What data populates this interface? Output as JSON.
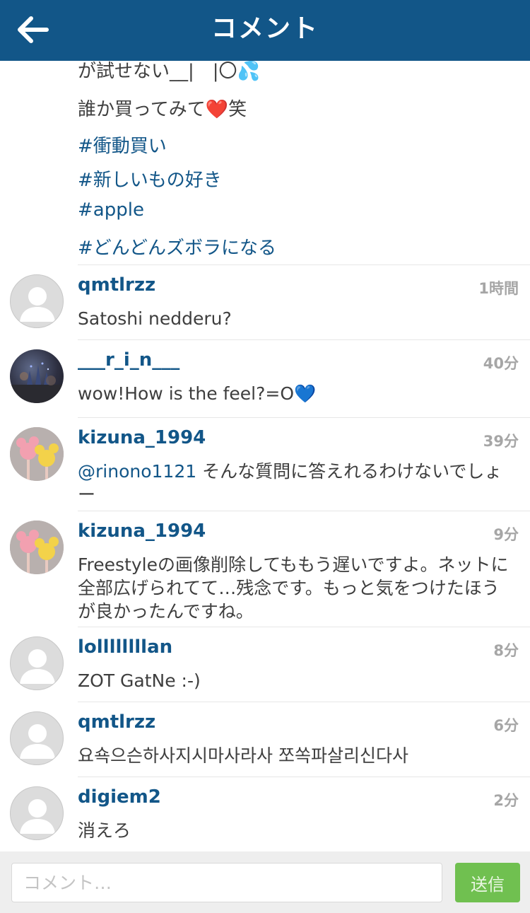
{
  "header": {
    "title": "コメント",
    "back_icon": "arrow-left-icon"
  },
  "caption": {
    "partial_line": "が試せない__|　|〇💦",
    "line2": "誰か買ってみて❤️笑",
    "tags": [
      "#衝動買い",
      "#新しいもの好き",
      "#apple",
      "#どんどんズボラになる"
    ]
  },
  "comments": [
    {
      "user": "qmtlrzz",
      "time": "1時間",
      "text": "Satoshi nedderu?",
      "avatar": "default-avatar-icon"
    },
    {
      "user": "___r_i_n___",
      "time": "40分",
      "text": "wow!How is the feel?=O💙",
      "avatar": "photo"
    },
    {
      "user": "kizuna_1994",
      "time": "39分",
      "mention": "@rinono1121",
      "text": " そんな質問に答えれるわけないでしょー",
      "avatar": "photo"
    },
    {
      "user": "kizuna_1994",
      "time": "9分",
      "text": "Freestyleの画像削除してももう遅いですよ。ネットに全部広げられてて…残念です。もっと気をつけたほうが良かったんですね。",
      "avatar": "photo"
    },
    {
      "user": "lollllllllan",
      "time": "8分",
      "text": "ZOT GatNe :-)",
      "avatar": "default-avatar-icon"
    },
    {
      "user": "qmtlrzz",
      "time": "6分",
      "text": "요쇽으슨하사지시마사라사 쪼쏙파살리신다사",
      "avatar": "default-avatar-icon"
    },
    {
      "user": "digiem2",
      "time": "2分",
      "text": "消えろ",
      "avatar": "default-avatar-icon"
    }
  ],
  "footer": {
    "input_placeholder": "コメント…",
    "send_label": "送信"
  },
  "colors": {
    "header_bg": "#125688",
    "link": "#125688",
    "send_button": "#70c050"
  }
}
